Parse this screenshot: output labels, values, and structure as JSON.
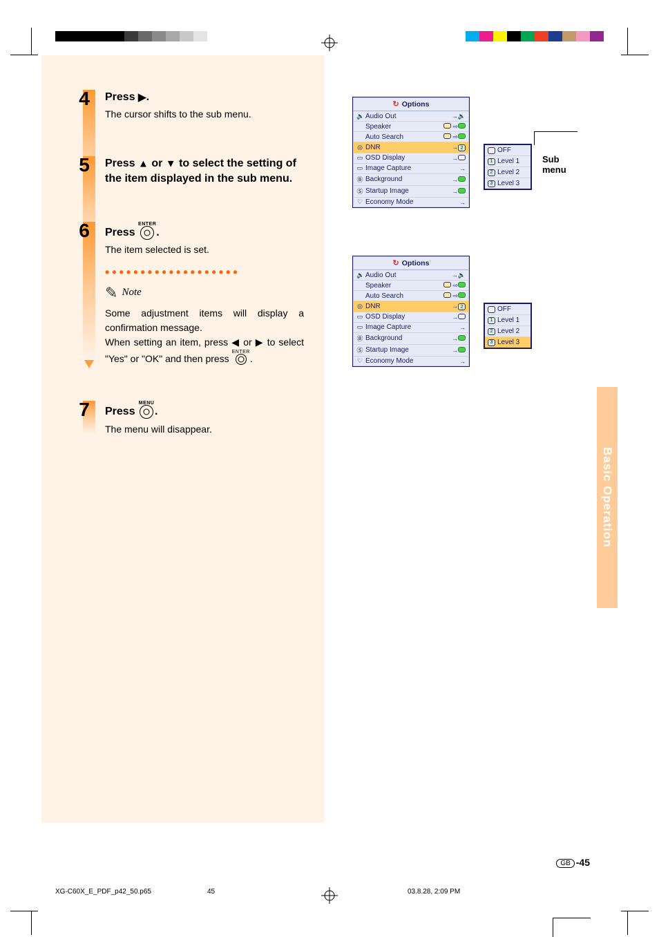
{
  "section_tab": "Basic Operation",
  "steps": {
    "4": {
      "num": "4",
      "title_a": "Press ",
      "title_glyph": "▶",
      "title_b": ".",
      "desc": "The cursor shifts to the sub menu."
    },
    "5": {
      "num": "5",
      "title_a": "Press ",
      "g1": "▲",
      "mid": " or ",
      "g2": "▼",
      "title_b": " to select the setting of the item displayed in the sub menu."
    },
    "6": {
      "num": "6",
      "title_a": "Press ",
      "btn_label": "ENTER",
      "title_b": ".",
      "desc": "The item selected is set.",
      "note_label": "Note",
      "note_a": "Some adjustment items will display a confirmation message.",
      "note_b_1": "When setting an item, press ",
      "note_b_g1": "◀",
      "note_b_2": " or ",
      "note_b_g2": "▶",
      "note_b_3": " to select \"Yes\" or \"OK\" and then press ",
      "note_b_4": "."
    },
    "7": {
      "num": "7",
      "title_a": "Press ",
      "btn_label": "MENU",
      "title_b": ".",
      "desc": "The menu will disappear."
    }
  },
  "osd": {
    "title": "Options",
    "items": {
      "audio_out": "Audio Out",
      "speaker": "Speaker",
      "auto_search": "Auto Search",
      "dnr": "DNR",
      "osd_display": "OSD Display",
      "image_capture": "Image Capture",
      "background": "Background",
      "startup_image": "Startup Image",
      "economy_mode": "Economy Mode"
    },
    "dnr_val": "2",
    "submenu": {
      "off": "OFF",
      "l1": "Level 1",
      "l2": "Level 2",
      "l3": "Level 3"
    },
    "callout": "Sub menu"
  },
  "page_num": "-45",
  "region": "GB",
  "footer": {
    "path": "XG-C60X_E_PDF_p42_50.p65",
    "mid": "45",
    "date": "03.8.28, 2:09 PM"
  },
  "color_swatches_left": [
    "#000",
    "#000",
    "#000",
    "#000",
    "#000",
    "#3a3a3a",
    "#6a6a6a",
    "#8a8a8a",
    "#a8a8a8",
    "#c8c8c8",
    "#e4e4e4"
  ],
  "color_swatches_right": [
    "#00aeef",
    "#ed1c8f",
    "#fff200",
    "#000000",
    "#00a651",
    "#ef4023",
    "#1b3e93",
    "#c49a6c",
    "#f49ac1",
    "#92278f"
  ]
}
